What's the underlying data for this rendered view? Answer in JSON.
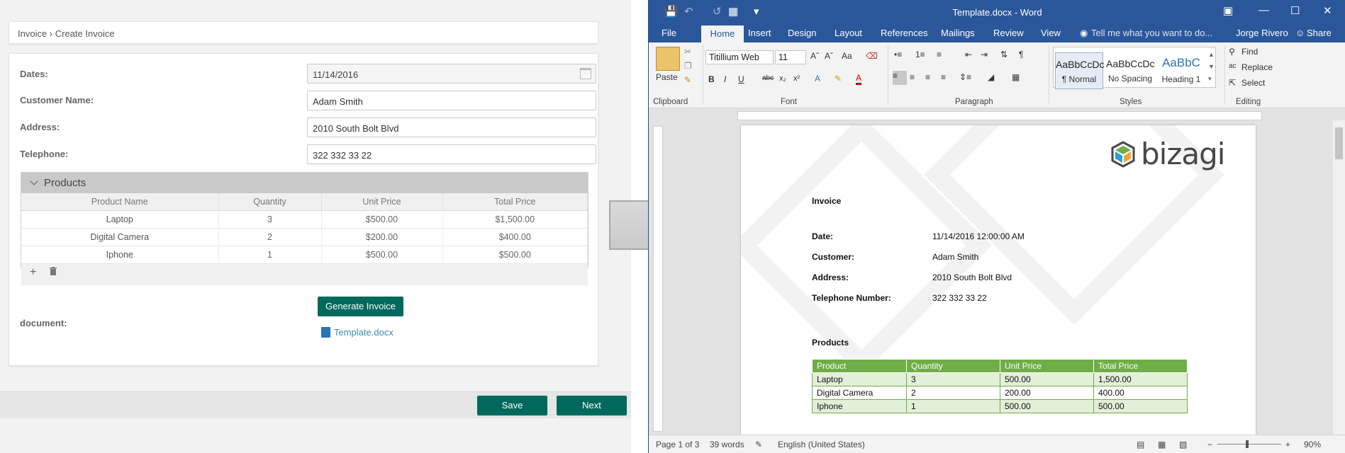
{
  "form": {
    "breadcrumb": "Invoice › Create Invoice",
    "fields": [
      {
        "label": "Dates:",
        "value": "11/14/2016"
      },
      {
        "label": "Customer Name:",
        "value": "Adam Smith"
      },
      {
        "label": "Address:",
        "value": "2010 South Bolt Blvd"
      },
      {
        "label": "Telephone:",
        "value": "322 332 33 22"
      }
    ],
    "products_title": "Products",
    "columns": [
      "Product Name",
      "Quantity",
      "Unit Price",
      "Total Price"
    ],
    "rows": [
      [
        "Laptop",
        "3",
        "$500.00",
        "$1,500.00"
      ],
      [
        "Digital Camera",
        "2",
        "$200.00",
        "$400.00"
      ],
      [
        "Iphone",
        "1",
        "$500.00",
        "$500.00"
      ]
    ],
    "add_icon": "+",
    "delete_icon": "trash-icon",
    "generate_label": "Generate Invoice",
    "document_label": "document:",
    "document_file": "Template.docx",
    "save_label": "Save",
    "next_label": "Next"
  },
  "word": {
    "title": "Template.docx - Word",
    "tabs": [
      "File",
      "Home",
      "Insert",
      "Design",
      "Layout",
      "References",
      "Mailings",
      "Review",
      "View"
    ],
    "tell_me": "Tell me what you want to do...",
    "user": "Jorge Rivero",
    "share": "Share",
    "font_name": "Titillium Web",
    "font_size": "11",
    "paste_label": "Paste",
    "groups": [
      "Clipboard",
      "Font",
      "Paragraph",
      "Styles",
      "Editing"
    ],
    "styles": [
      {
        "preview": "AaBbCcDc",
        "name": "¶ Normal"
      },
      {
        "preview": "AaBbCcDc",
        "name": "No Spacing"
      },
      {
        "preview": "AaBbC",
        "name": "Heading 1"
      }
    ],
    "editing": [
      "Find",
      "Replace",
      "Select"
    ],
    "status": {
      "page": "Page 1 of 3",
      "words": "39 words",
      "language": "English (United States)",
      "zoom": "90%"
    },
    "doc": {
      "logo_text": "bizagi",
      "heading": "Invoice",
      "lines": [
        {
          "label": "Date:",
          "value": "11/14/2016 12:00:00 AM"
        },
        {
          "label": "Customer:",
          "value": "Adam Smith"
        },
        {
          "label": "Address:",
          "value": "2010 South Bolt Blvd"
        },
        {
          "label": "Telephone Number:",
          "value": "322 332 33 22"
        }
      ],
      "products_heading": "Products",
      "columns": [
        "Product",
        "Quantity",
        "Unit Price",
        "Total Price"
      ],
      "rows": [
        [
          "Laptop",
          "3",
          "500.00",
          "1,500.00"
        ],
        [
          "Digital Camera",
          "2",
          "200.00",
          "400.00"
        ],
        [
          "Iphone",
          "1",
          "500.00",
          "500.00"
        ]
      ]
    }
  },
  "colors": {
    "primary_green": "#00695c",
    "word_blue": "#2b579a",
    "table_green": "#6fad47"
  }
}
